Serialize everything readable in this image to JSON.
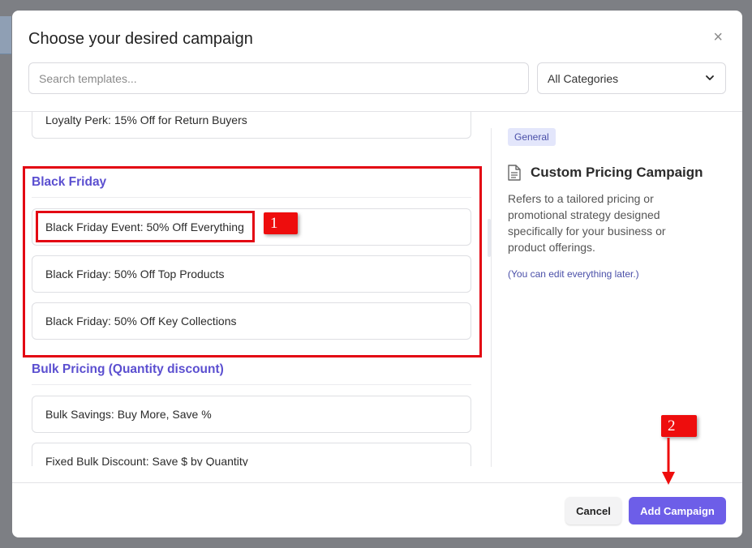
{
  "dialog": {
    "title": "Choose your desired campaign",
    "close_symbol": "×"
  },
  "search": {
    "placeholder": "Search templates...",
    "value": ""
  },
  "category_select": {
    "selected": "All Categories"
  },
  "templates": {
    "top_item": "Loyalty Perk: 15% Off for Return Buyers",
    "groups": [
      {
        "title": "Black Friday",
        "items": [
          "Black Friday Event: 50% Off Everything",
          "Black Friday: 50% Off Top Products",
          "Black Friday: 50% Off Key Collections"
        ]
      },
      {
        "title": "Bulk Pricing (Quantity discount)",
        "items": [
          "Bulk Savings: Buy More, Save %",
          "Fixed Bulk Discount: Save $ by Quantity"
        ]
      }
    ]
  },
  "details": {
    "badge": "General",
    "icon": "document-icon",
    "title": "Custom Pricing Campaign",
    "description": "Refers to a tailored pricing or promotional strategy designed specifically for your business or product offerings.",
    "note": "(You can edit everything later.)"
  },
  "footer": {
    "cancel_label": "Cancel",
    "add_label": "Add Campaign"
  },
  "annotations": {
    "marker_1": "1",
    "marker_2": "2",
    "highlight_color": "#e30613"
  },
  "colors": {
    "accent": "#6d5ee8",
    "group_title": "#5b4fd0"
  }
}
